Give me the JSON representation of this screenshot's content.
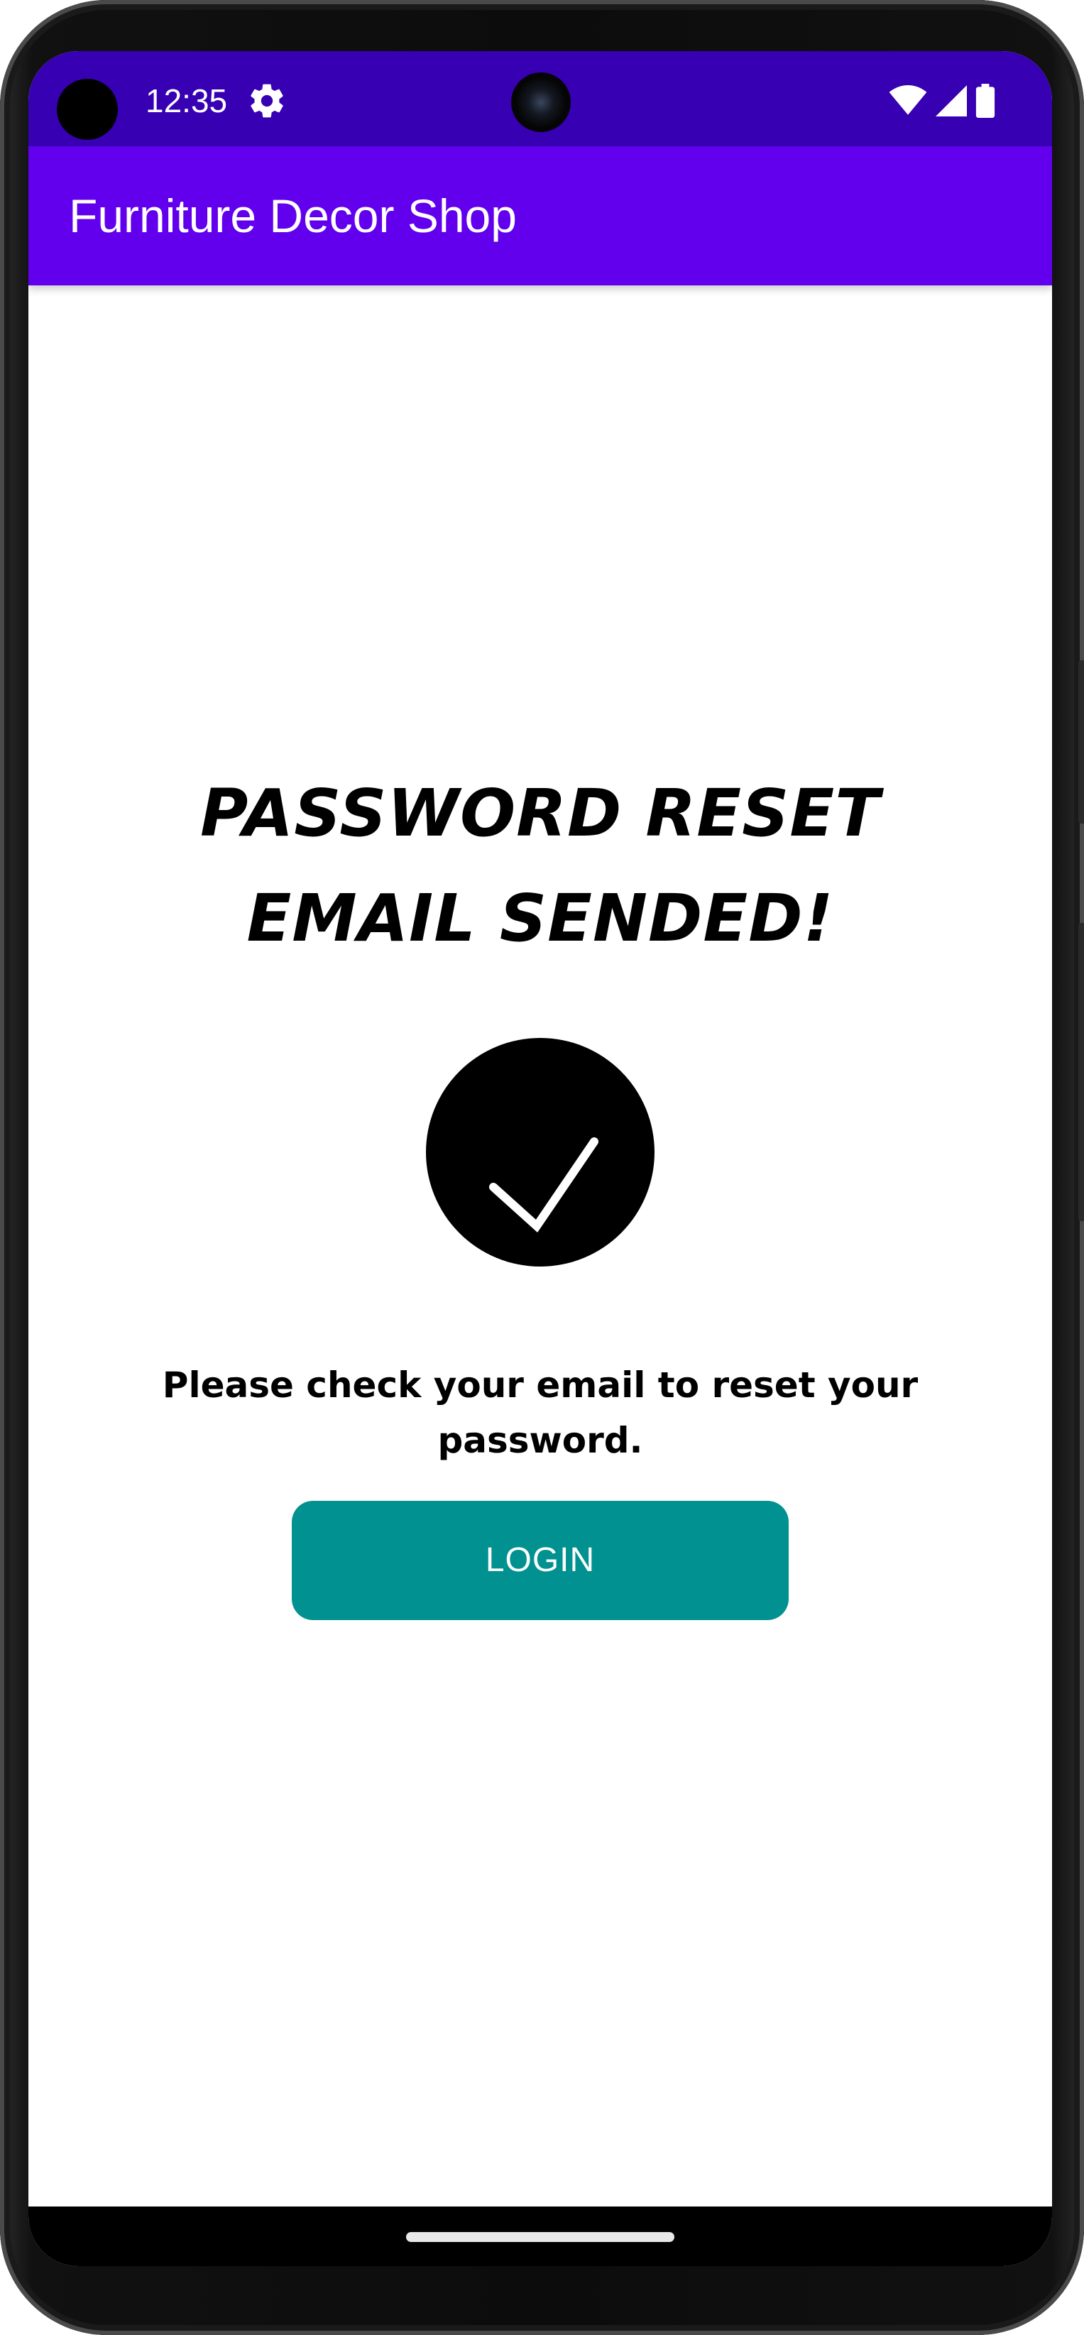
{
  "status_bar": {
    "time": "12:35",
    "icons": [
      "settings-gear-icon",
      "wifi-icon",
      "cellular-signal-icon",
      "battery-icon"
    ],
    "background_color": "#3700b3"
  },
  "app_bar": {
    "title": "Furniture Decor Shop",
    "background_color": "#6200ee"
  },
  "main": {
    "headline_line1": "PASSWORD RESET",
    "headline_line2": "EMAIL SENDED!",
    "success_icon": "checkmark-circle-icon",
    "message": "Please check your email to reset your password.",
    "login_label": "LOGIN",
    "login_color": "#009190"
  }
}
